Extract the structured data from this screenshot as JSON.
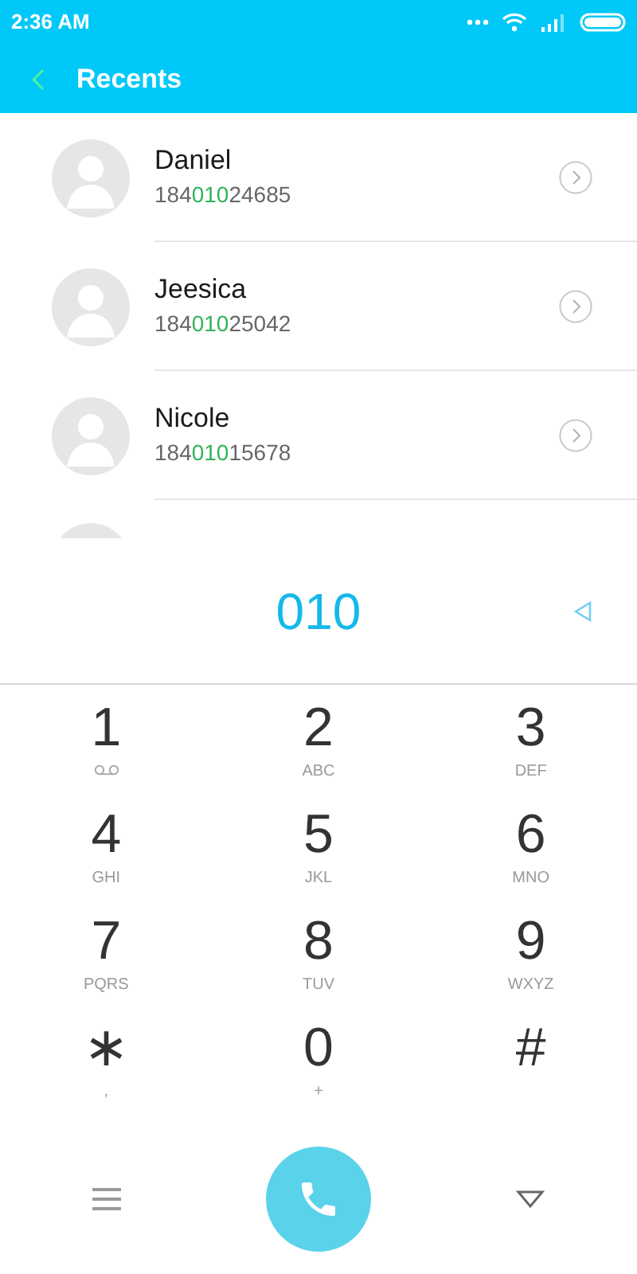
{
  "status_bar": {
    "time": "2:36 AM"
  },
  "header": {
    "title": "Recents"
  },
  "contacts": [
    {
      "kind": "full",
      "name": "Daniel",
      "number_before": "184",
      "number_match": "010",
      "number_after": "24685"
    },
    {
      "kind": "full",
      "name": "Jeesica",
      "number_before": "184",
      "number_match": "010",
      "number_after": "25042"
    },
    {
      "kind": "full",
      "name": "Nicole",
      "number_before": "184",
      "number_match": "010",
      "number_after": "15678"
    },
    {
      "kind": "cut"
    }
  ],
  "dialed": "010",
  "keys": [
    {
      "digit": "1",
      "kind": "voicemail"
    },
    {
      "digit": "2",
      "kind": "letters",
      "sub": "ABC"
    },
    {
      "digit": "3",
      "kind": "letters",
      "sub": "DEF"
    },
    {
      "digit": "4",
      "kind": "letters",
      "sub": "GHI"
    },
    {
      "digit": "5",
      "kind": "letters",
      "sub": "JKL"
    },
    {
      "digit": "6",
      "kind": "letters",
      "sub": "MNO"
    },
    {
      "digit": "7",
      "kind": "letters",
      "sub": "PQRS"
    },
    {
      "digit": "8",
      "kind": "letters",
      "sub": "TUV"
    },
    {
      "digit": "9",
      "kind": "letters",
      "sub": "WXYZ"
    },
    {
      "digit": "∗",
      "kind": "letters",
      "sub": ","
    },
    {
      "digit": "0",
      "kind": "letters",
      "sub": "+"
    },
    {
      "digit": "#",
      "kind": "none"
    }
  ]
}
